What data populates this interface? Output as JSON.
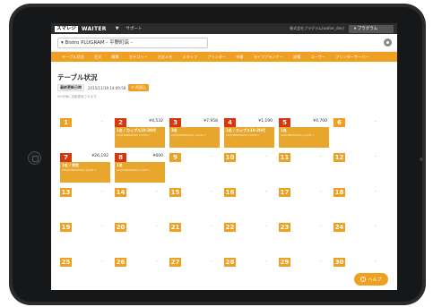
{
  "header": {
    "logo": "スマレジ",
    "app_name": "WAITER",
    "support": "サポート",
    "account": "株式会社プラグラム(waiter_dev)",
    "program_button": "プラグラム"
  },
  "store": {
    "selected": "Bistro PLUGRAM - 平野町店 -"
  },
  "nav": {
    "items": [
      "テーブル状況",
      "注文",
      "精算",
      "カテゴリー",
      "注文メモ",
      "スタッフ",
      "プリンター",
      "卓番",
      "ライフプランナー",
      "設備",
      "ユーザー",
      "プリンターサーバー"
    ]
  },
  "page": {
    "title": "テーブル状況",
    "update_label": "最終更新日時",
    "update_time": "2015/11/19 14:09:58",
    "refresh_label": "再読込",
    "note": "※5分毎に自動更新されます。"
  },
  "tables": [
    {
      "num": "1",
      "status": "empty",
      "amount": "-"
    },
    {
      "num": "2",
      "status": "used",
      "amount": "¥4,532",
      "line1": "1名 / カップル10-20代",
      "line2": "2A/JTPM000(00) 1/2(3F-) "
    },
    {
      "num": "3",
      "status": "used",
      "amount": "¥7,958",
      "line1": "3名",
      "line2": "2/H/JPPM000(00) 1/2(3F-)"
    },
    {
      "num": "4",
      "status": "used",
      "amount": "¥1,190",
      "line1": "1名 / カップル10-20代",
      "line2": "3A/JTPM000(00) 1/2(3F-)"
    },
    {
      "num": "5",
      "status": "used",
      "amount": "¥4,700",
      "line1": "1名",
      "line2": "3A/JTPM000(00) 1/2(3F-)"
    },
    {
      "num": "6",
      "status": "empty",
      "amount": "-"
    },
    {
      "num": "7",
      "status": "used",
      "amount": "¥26,192",
      "line1": "1名 / 男性",
      "line2": "2/H/JPPM000(00) 1/2(3F-)"
    },
    {
      "num": "8",
      "status": "used",
      "amount": "¥600",
      "line1": "1名",
      "line2": "2A/JTPM000(00) 1/2(3F-)"
    },
    {
      "num": "9",
      "status": "empty",
      "amount": "-"
    },
    {
      "num": "10",
      "status": "empty",
      "amount": "-"
    },
    {
      "num": "11",
      "status": "empty",
      "amount": "-"
    },
    {
      "num": "12",
      "status": "empty",
      "amount": "-"
    },
    {
      "num": "13",
      "status": "empty",
      "amount": "-"
    },
    {
      "num": "14",
      "status": "empty",
      "amount": "-"
    },
    {
      "num": "15",
      "status": "empty",
      "amount": "-"
    },
    {
      "num": "16",
      "status": "empty",
      "amount": "-"
    },
    {
      "num": "17",
      "status": "empty",
      "amount": "-"
    },
    {
      "num": "18",
      "status": "empty",
      "amount": "-"
    },
    {
      "num": "19",
      "status": "empty",
      "amount": "-"
    },
    {
      "num": "20",
      "status": "empty",
      "amount": "-"
    },
    {
      "num": "21",
      "status": "empty",
      "amount": "-"
    },
    {
      "num": "22",
      "status": "empty",
      "amount": "-"
    },
    {
      "num": "23",
      "status": "empty",
      "amount": "-"
    },
    {
      "num": "24",
      "status": "empty",
      "amount": "-"
    },
    {
      "num": "25",
      "status": "empty",
      "amount": "-"
    },
    {
      "num": "26",
      "status": "empty",
      "amount": "-"
    },
    {
      "num": "27",
      "status": "empty",
      "amount": "-"
    },
    {
      "num": "28",
      "status": "empty",
      "amount": "-"
    },
    {
      "num": "29",
      "status": "empty",
      "amount": "-"
    },
    {
      "num": "30",
      "status": "empty",
      "amount": "-"
    }
  ],
  "help": {
    "label": "ヘルプ",
    "icon": "question-icon"
  },
  "colors": {
    "accent": "#f0a020",
    "occupied": "#d9350f",
    "header": "#2b2b2b"
  }
}
